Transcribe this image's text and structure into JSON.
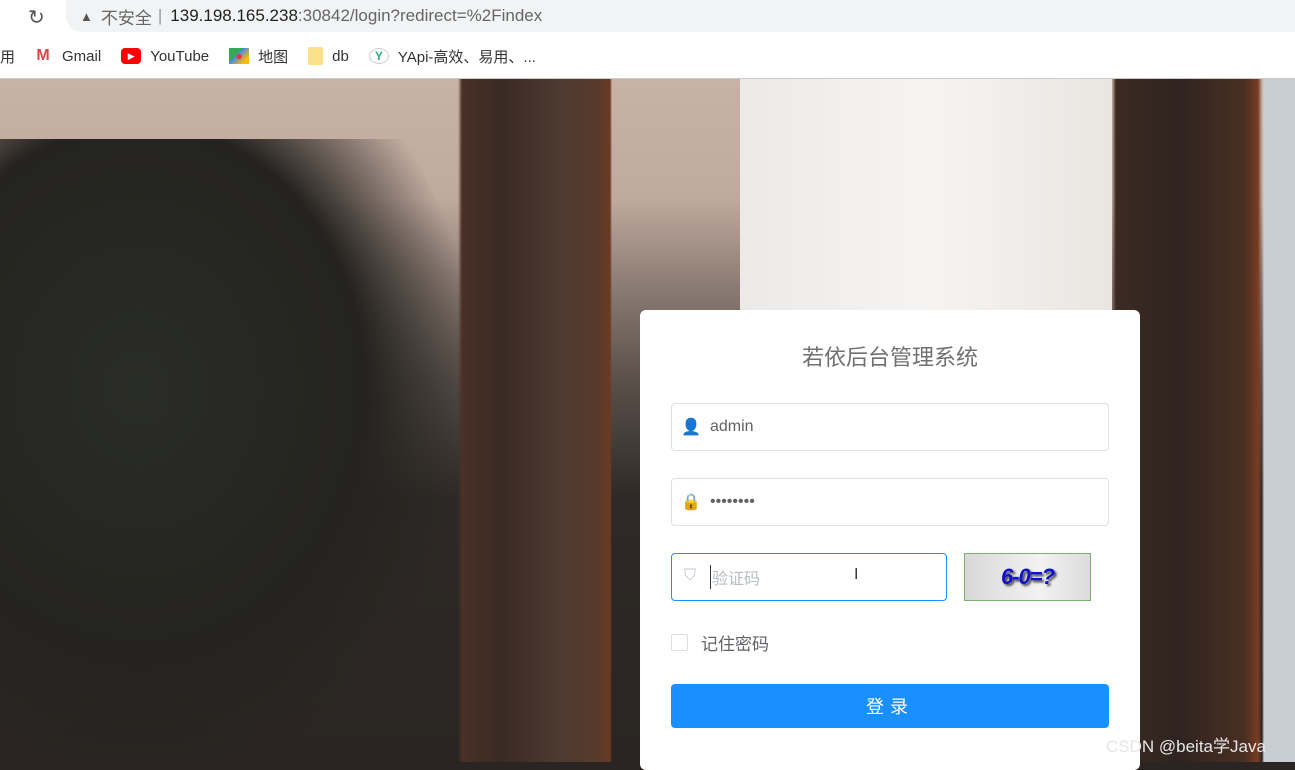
{
  "browser": {
    "security_label": "不安全",
    "url_host": "139.198.165.238",
    "url_path": ":30842/login?redirect=%2Findex",
    "bookmarks": [
      {
        "label": "Gmail",
        "icon": "gmail-icon"
      },
      {
        "label": "YouTube",
        "icon": "youtube-icon"
      },
      {
        "label": "地图",
        "icon": "maps-icon"
      },
      {
        "label": "db",
        "icon": "folder-icon"
      },
      {
        "label": "YApi-高效、易用、...",
        "icon": "yapi-icon"
      }
    ],
    "bookmark_partial": "用"
  },
  "login": {
    "title": "若依后台管理系统",
    "username": "admin",
    "password_masked": "••••••••",
    "captcha_placeholder": "验证码",
    "captcha_image_text": "6-0=?",
    "remember_label": "记住密码",
    "submit_label": "登录"
  },
  "watermark": "CSDN @beita学Java",
  "colors": {
    "primary": "#1890ff",
    "captcha_text": "#1010d0"
  }
}
